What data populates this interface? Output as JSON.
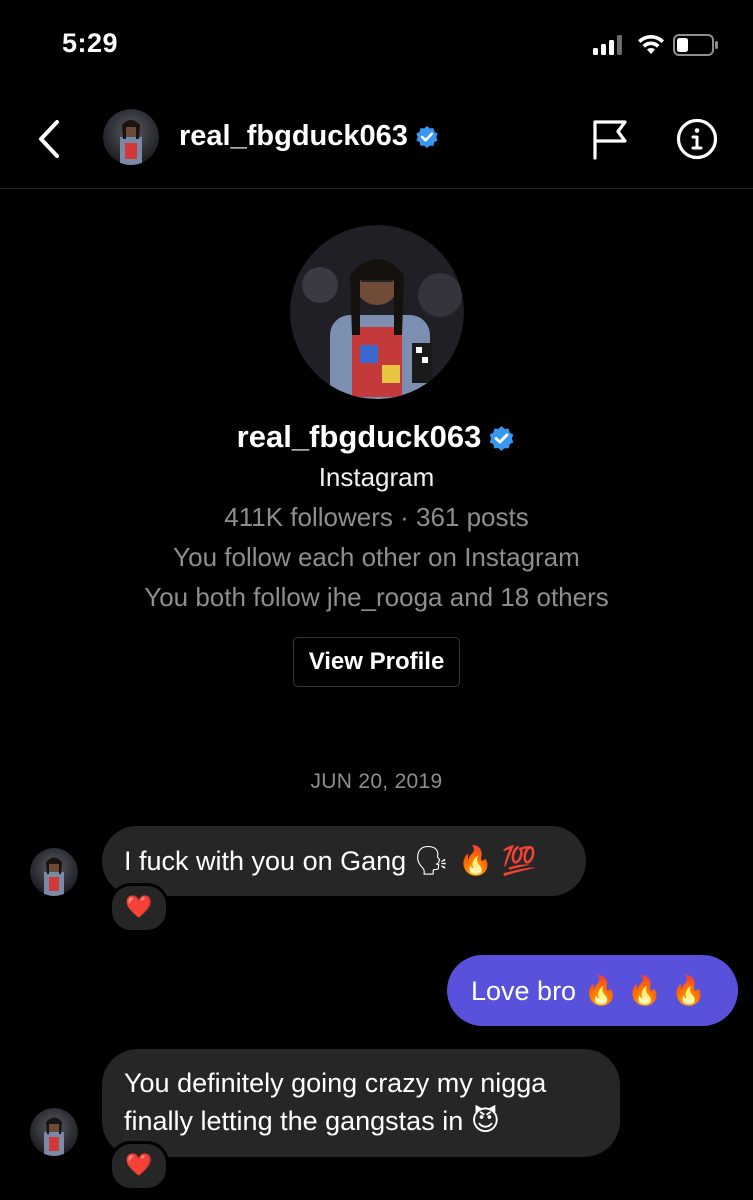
{
  "status_bar": {
    "time": "5:29",
    "signal_icon": "cellular-signal-icon",
    "wifi_icon": "wifi-icon",
    "battery_icon": "battery-icon"
  },
  "header": {
    "back_icon": "chevron-left-icon",
    "username": "real_fbgduck063",
    "verified_icon": "verified-badge-icon",
    "flag_icon": "flag-icon",
    "info_icon": "info-icon"
  },
  "profile": {
    "username": "real_fbgduck063",
    "subtitle": "Instagram",
    "stats": "411K followers · 361 posts",
    "mutual_follow": "You follow each other on Instagram",
    "mutual_friends": "You both follow jhe_rooga and 18 others",
    "view_profile_label": "View Profile"
  },
  "conversation": {
    "date": "JUN 20, 2019",
    "messages": [
      {
        "direction": "incoming",
        "text": "I fuck with you on Gang",
        "emojis": "🗣 🔥 💯",
        "reaction": "❤️"
      },
      {
        "direction": "outgoing",
        "text": "Love bro",
        "emojis": "🔥 🔥 🔥"
      },
      {
        "direction": "incoming",
        "line1": "You definitely going crazy my nigga",
        "line2": "finally letting the gangstas in",
        "emojis": "😈",
        "reaction": "❤️"
      }
    ]
  },
  "colors": {
    "background": "#000000",
    "incoming_bubble": "#262626",
    "outgoing_bubble": "#5851db",
    "verified_blue": "#3897f0",
    "muted_text": "#8e8e8e"
  }
}
